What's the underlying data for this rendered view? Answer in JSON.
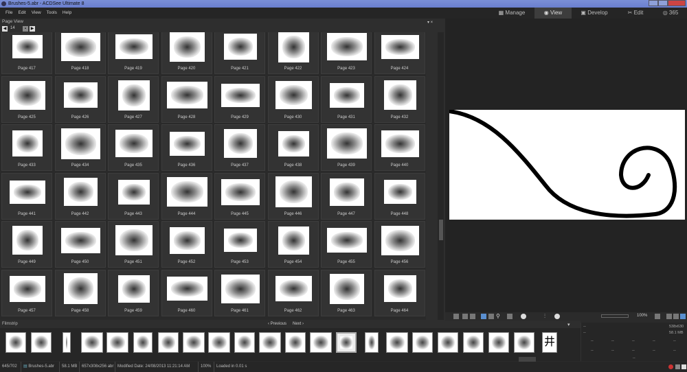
{
  "window": {
    "title": "Brushes-5.abr - ACDSee Ultimate 8"
  },
  "menu": [
    "File",
    "Edit",
    "View",
    "Tools",
    "Help"
  ],
  "modes": [
    {
      "label": "Manage",
      "icon": "grid-icon"
    },
    {
      "label": "View",
      "icon": "eye-icon",
      "active": true
    },
    {
      "label": "Develop",
      "icon": "develop-icon"
    },
    {
      "label": "Edit",
      "icon": "tools-icon"
    },
    {
      "label": "365",
      "icon": "cloud-365-icon"
    }
  ],
  "page_view": {
    "title": "Page View",
    "page_number": "14"
  },
  "pages": [
    "Page 417",
    "Page 418",
    "Page 419",
    "Page 420",
    "Page 421",
    "Page 422",
    "Page 423",
    "Page 424",
    "Page 425",
    "Page 426",
    "Page 427",
    "Page 428",
    "Page 429",
    "Page 430",
    "Page 431",
    "Page 432",
    "Page 433",
    "Page 434",
    "Page 435",
    "Page 436",
    "Page 437",
    "Page 438",
    "Page 439",
    "Page 440",
    "Page 441",
    "Page 442",
    "Page 443",
    "Page 444",
    "Page 445",
    "Page 446",
    "Page 447",
    "Page 448",
    "Page 449",
    "Page 450",
    "Page 451",
    "Page 452",
    "Page 453",
    "Page 454",
    "Page 455",
    "Page 456",
    "Page 457",
    "Page 458",
    "Page 459",
    "Page 460",
    "Page 461",
    "Page 462",
    "Page 463",
    "Page 464"
  ],
  "filmstrip": {
    "title": "Filmstrip",
    "previous": "Previous",
    "next": "Next",
    "count": 22,
    "selected_index": 13,
    "last_glyph": "井"
  },
  "viewer": {
    "zoom": "100%"
  },
  "info": {
    "dims": "538x630",
    "size": "58.1 MB",
    "placeholder": "--"
  },
  "status": {
    "position": "645/702",
    "filename": "Brushes-5.abr",
    "filesize": "58.1 MB",
    "dimensions": "657x308x256 abr",
    "modified": "Modified Date: 24/08/2013 11:21:14 AM",
    "zoom": "100%",
    "loaded": "Loaded in 0.01 s"
  }
}
